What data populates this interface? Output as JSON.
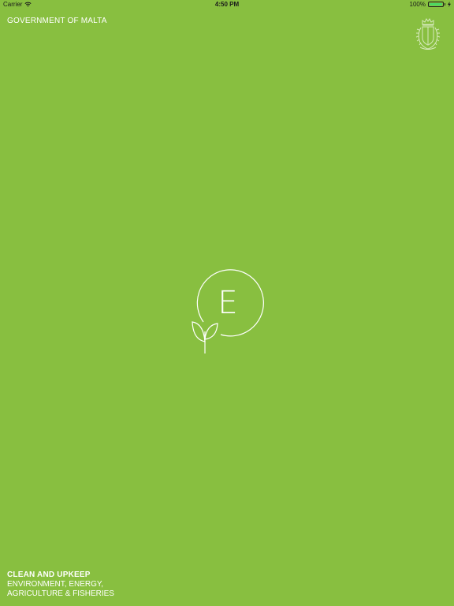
{
  "status_bar": {
    "carrier": "Carrier",
    "time": "4:50 PM",
    "battery_percent": "100%",
    "battery_level": 1.0,
    "wifi_icon": "wifi-icon",
    "charging_icon": "bolt-icon"
  },
  "header": {
    "title": "GOVERNMENT OF MALTA",
    "emblem_icon": "coat-of-arms-icon"
  },
  "logo": {
    "letter": "E",
    "icon": "sprout-icon"
  },
  "footer": {
    "heading": "CLEAN AND UPKEEP",
    "line1": "ENVIRONMENT, ENERGY,",
    "line2": "AGRICULTURE & FISHERIES"
  },
  "colors": {
    "background": "#88bf40",
    "text": "#ffffff",
    "battery": "#4cd964"
  }
}
